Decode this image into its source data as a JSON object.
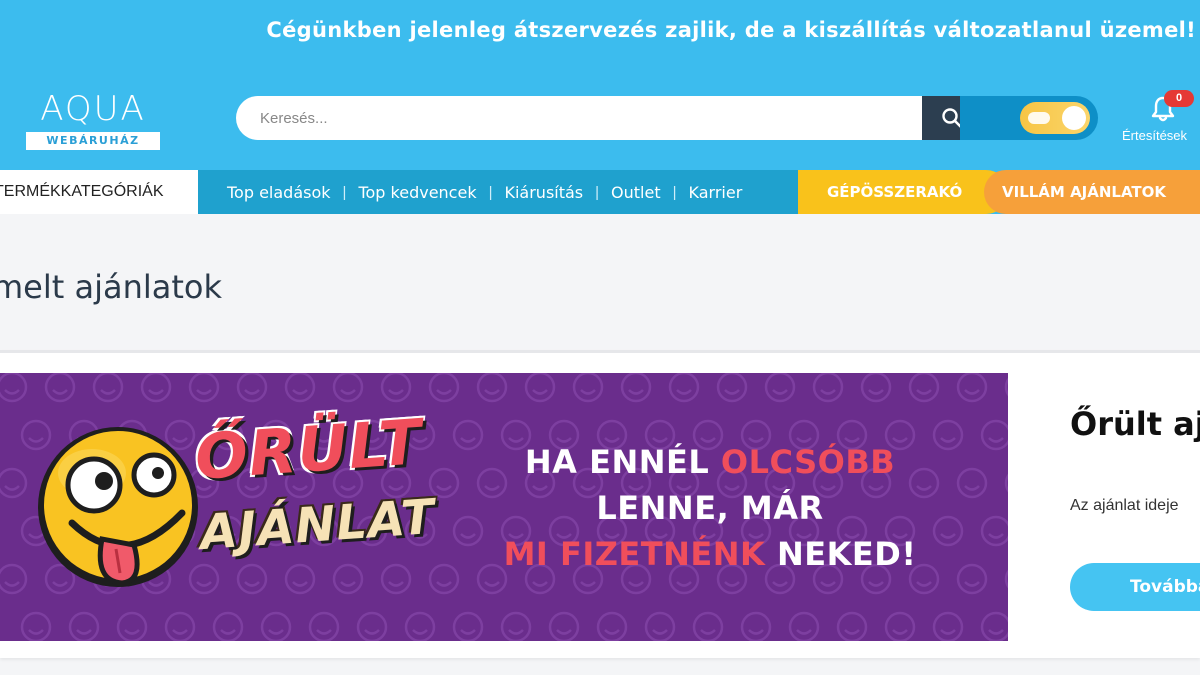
{
  "announcement": {
    "text": "Cégünkben jelenleg átszervezés zajlik, de a kiszállítás változatlanul üzemel!"
  },
  "header": {
    "logo": {
      "main": "AQUA",
      "sub": "WEBÁRUHÁZ"
    },
    "search": {
      "placeholder": "Keresés...",
      "value": ""
    },
    "notifications": {
      "label": "Értesítések",
      "count": "0"
    }
  },
  "nav": {
    "categories_label": "TERMÉKKATEGÓRIÁK",
    "links": [
      "Top eladások",
      "Top kedvencek",
      "Kiárusítás",
      "Outlet",
      "Karrier"
    ],
    "special1": "GÉPÖSSZERAKÓ",
    "special2": "VILLÁM AJÁNLATOK"
  },
  "page": {
    "title": "melt ajánlatok"
  },
  "offer": {
    "banner": {
      "brand_line1": "ŐRÜLT",
      "brand_line2": "AJÁNLAT",
      "tag_line1_a": "HA ENNÉL ",
      "tag_line1_b": "OLCSÓBB",
      "tag_line2": "LENNE, MÁR",
      "tag_line3_a": "MI FIZETNÉNK",
      "tag_line3_b": " NEKED!"
    },
    "title": "Őrült aj",
    "description": "Az ajánlat ideje",
    "button_label": "Továbbá"
  },
  "colors": {
    "brand_blue": "#3cbcee",
    "nav_dark_blue": "#1fa1ce",
    "search_button": "#2c3e50",
    "yellow": "#f9c21b",
    "orange": "#f6a03a",
    "banner_purple": "#6a2d8c",
    "accent_red": "#f04e5b"
  }
}
